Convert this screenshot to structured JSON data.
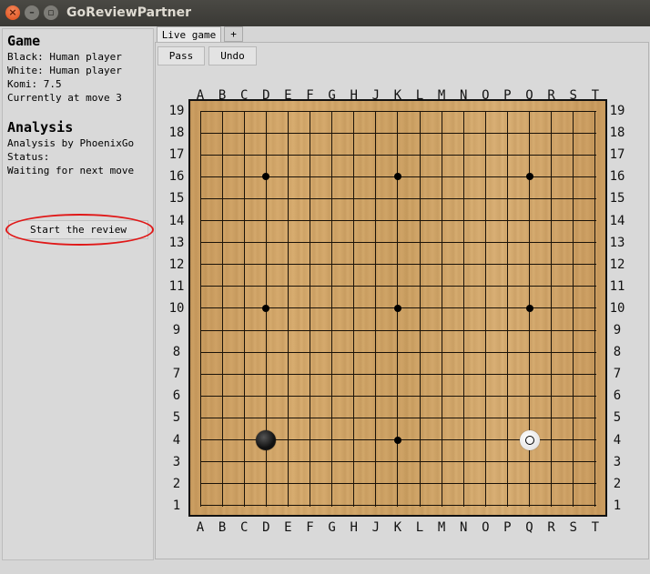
{
  "window": {
    "title": "GoReviewPartner"
  },
  "game_panel": {
    "heading": "Game",
    "black": "Black: Human player",
    "white": "White: Human player",
    "komi": "Komi: 7.5",
    "move": "Currently at move 3"
  },
  "analysis_panel": {
    "heading": "Analysis",
    "engine": "Analysis by PhoenixGo",
    "status_label": "Status:",
    "status_value": "Waiting for next move"
  },
  "review_button": {
    "label": "Start the review"
  },
  "tabs": [
    {
      "label": "Live game"
    },
    {
      "label": "+"
    }
  ],
  "toolbar": {
    "pass_label": "Pass",
    "undo_label": "Undo"
  },
  "board": {
    "size": 19,
    "columns": [
      "A",
      "B",
      "C",
      "D",
      "E",
      "F",
      "G",
      "H",
      "J",
      "K",
      "L",
      "M",
      "N",
      "O",
      "P",
      "Q",
      "R",
      "S",
      "T"
    ],
    "rows": [
      "19",
      "18",
      "17",
      "16",
      "15",
      "14",
      "13",
      "12",
      "11",
      "10",
      "9",
      "8",
      "7",
      "6",
      "5",
      "4",
      "3",
      "2",
      "1"
    ],
    "hoshi": [
      [
        "D",
        "16"
      ],
      [
        "K",
        "16"
      ],
      [
        "Q",
        "16"
      ],
      [
        "D",
        "10"
      ],
      [
        "K",
        "10"
      ],
      [
        "Q",
        "10"
      ],
      [
        "D",
        "4"
      ],
      [
        "K",
        "4"
      ],
      [
        "Q",
        "4"
      ]
    ],
    "stones": [
      {
        "color": "black",
        "col": "D",
        "row": "4"
      },
      {
        "color": "white",
        "col": "Q",
        "row": "4",
        "last_move": true
      }
    ],
    "colors": {
      "wood": "#d2a66a",
      "line": "#1a1208",
      "highlight": "#e01818"
    }
  }
}
